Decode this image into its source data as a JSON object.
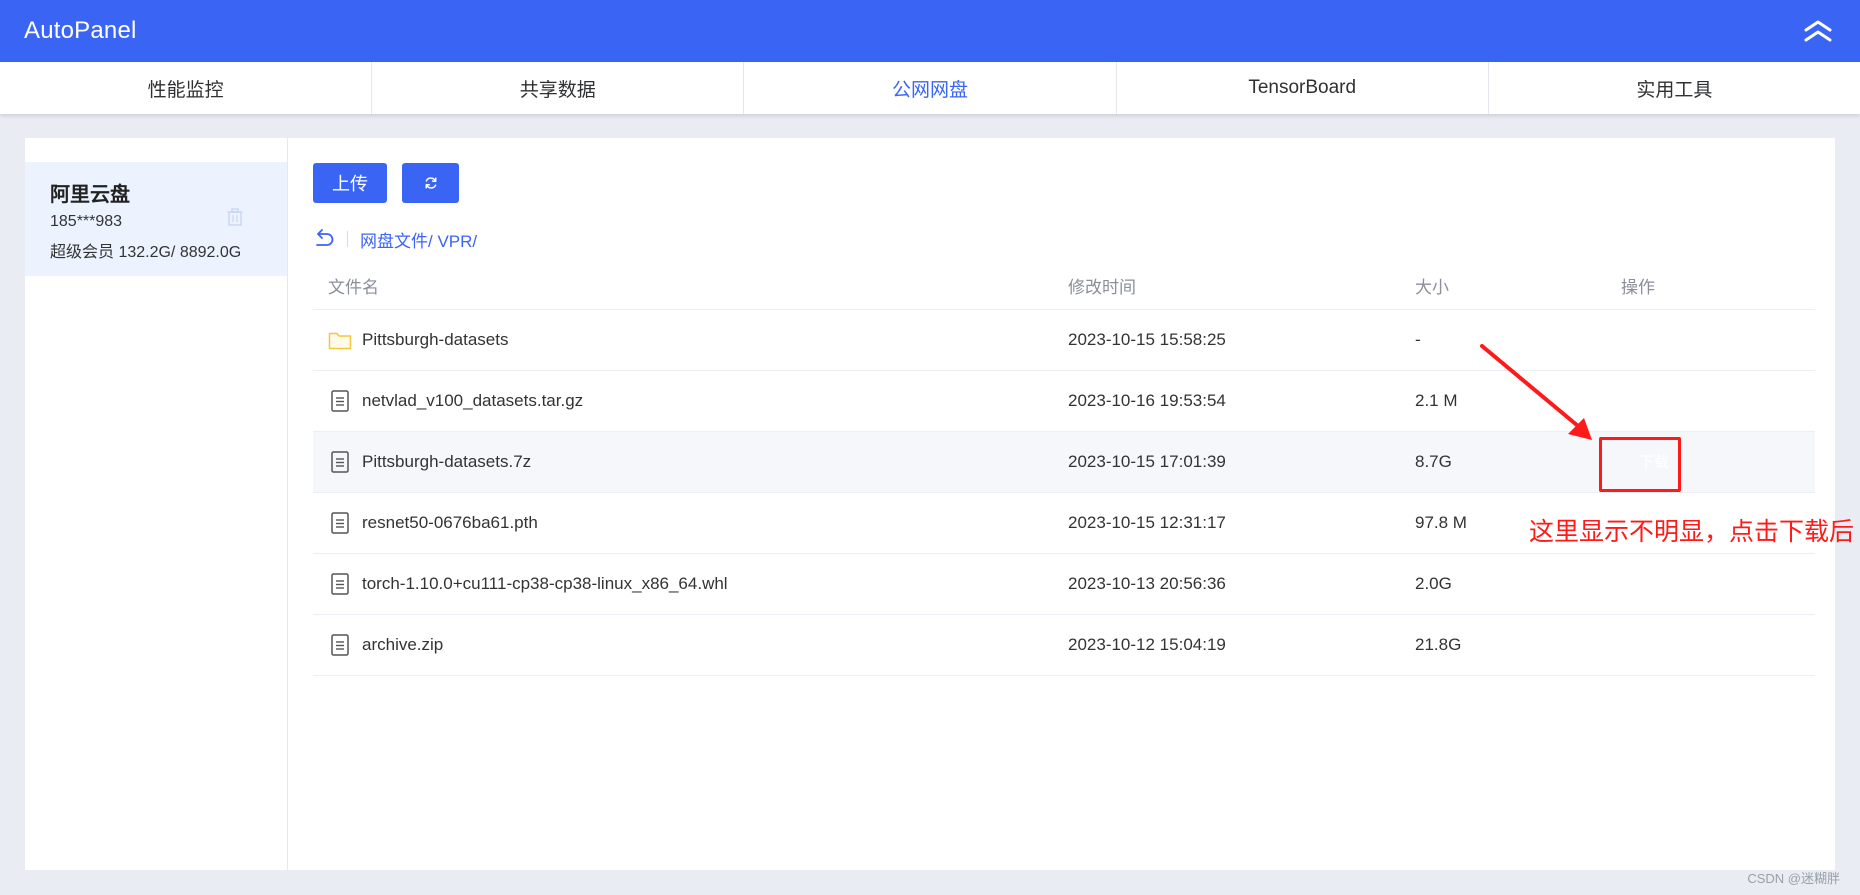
{
  "app": {
    "title": "AutoPanel"
  },
  "tabs": [
    {
      "label": "性能监控",
      "active": false
    },
    {
      "label": "共享数据",
      "active": false
    },
    {
      "label": "公网网盘",
      "active": true
    },
    {
      "label": "TensorBoard",
      "active": false
    },
    {
      "label": "实用工具",
      "active": false
    }
  ],
  "sidebar": {
    "disk": {
      "name": "阿里云盘",
      "account": "185***983",
      "usage": "超级会员 132.2G/ 8892.0G"
    }
  },
  "toolbar": {
    "upload_label": "上传",
    "refresh_icon": "refresh-icon"
  },
  "breadcrumb": {
    "path": "网盘文件/ VPR/"
  },
  "table": {
    "headers": {
      "name": "文件名",
      "time": "修改时间",
      "size": "大小",
      "op": "操作"
    },
    "rows": [
      {
        "icon": "folder-icon",
        "name": "Pittsburgh-datasets",
        "time": "2023-10-15 15:58:25",
        "size": "-",
        "action": ""
      },
      {
        "icon": "file-icon",
        "name": "netvlad_v100_datasets.tar.gz",
        "time": "2023-10-16 19:53:54",
        "size": "2.1 M",
        "action": ""
      },
      {
        "icon": "file-icon",
        "name": "Pittsburgh-datasets.7z",
        "time": "2023-10-15 17:01:39",
        "size": "8.7G",
        "action": "下载"
      },
      {
        "icon": "file-icon",
        "name": "resnet50-0676ba61.pth",
        "time": "2023-10-15 12:31:17",
        "size": "97.8 M",
        "action": ""
      },
      {
        "icon": "file-icon",
        "name": "torch-1.10.0+cu111-cp38-cp38-linux_x86_64.whl",
        "time": "2023-10-13 20:56:36",
        "size": "2.0G",
        "action": ""
      },
      {
        "icon": "file-icon",
        "name": "archive.zip",
        "time": "2023-10-12 15:04:19",
        "size": "21.8G",
        "action": ""
      }
    ]
  },
  "annotation": {
    "text": "这里显示不明显，点击下载后"
  },
  "watermark": "CSDN @迷糊胖",
  "colors": {
    "accent": "#3a64f3",
    "annotation": "#ff1a1a",
    "folder": "#f5c542"
  }
}
